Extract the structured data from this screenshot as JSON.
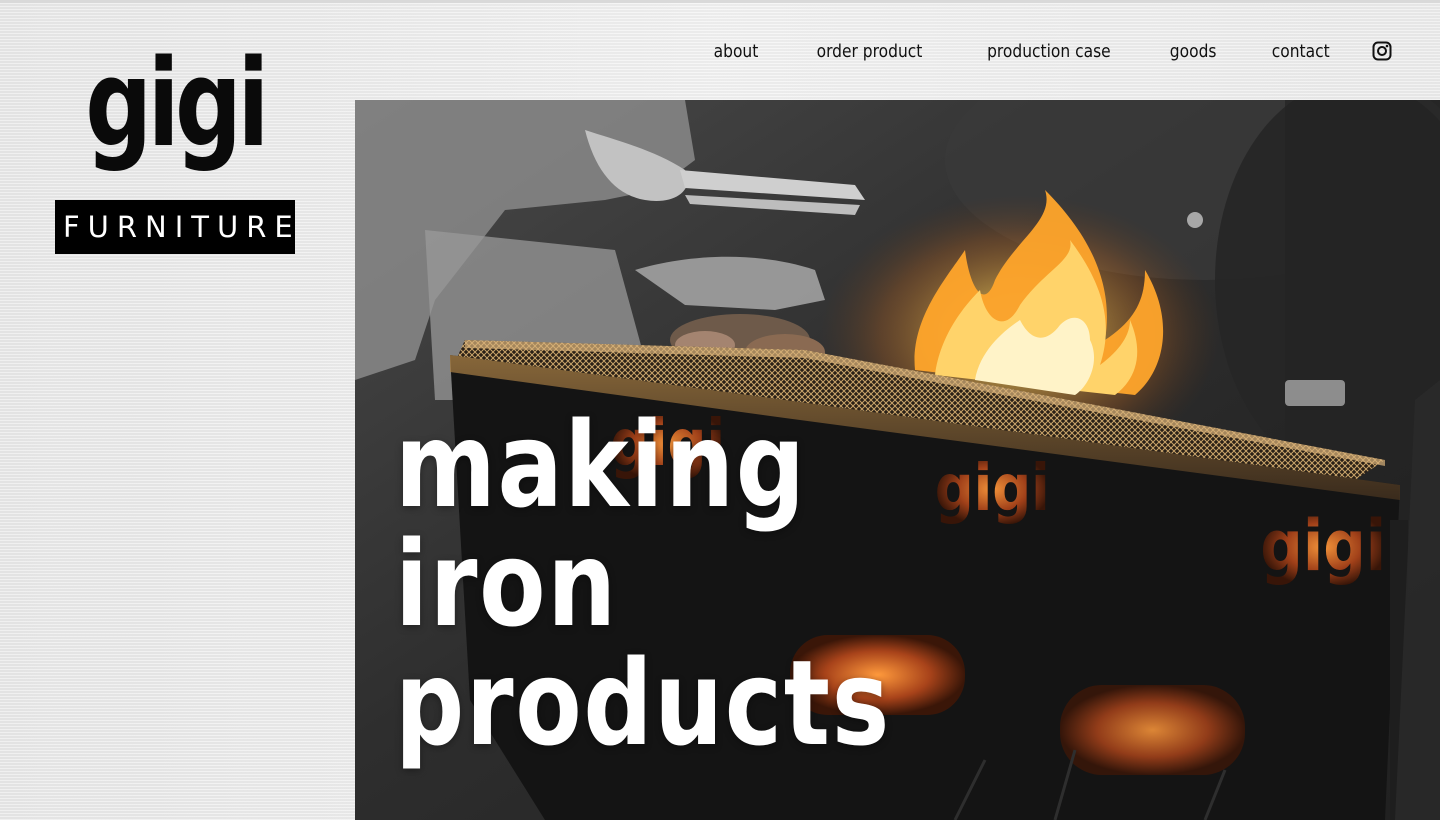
{
  "brand": {
    "wordmark": "gigi",
    "badge": "FURNITURE"
  },
  "nav": {
    "items": [
      {
        "label": "about"
      },
      {
        "label": "order product"
      },
      {
        "label": "production case"
      },
      {
        "label": "goods"
      },
      {
        "label": "contact"
      }
    ],
    "social_icon": "instagram-icon"
  },
  "hero": {
    "headline": [
      "making",
      "iron",
      "products"
    ],
    "image_description_icon": "photo-bbq-grill"
  },
  "colors": {
    "background": "#ececec",
    "text": "#111111",
    "badge_bg": "#000000",
    "headline": "#ffffff",
    "flame": "#ffb23a"
  }
}
